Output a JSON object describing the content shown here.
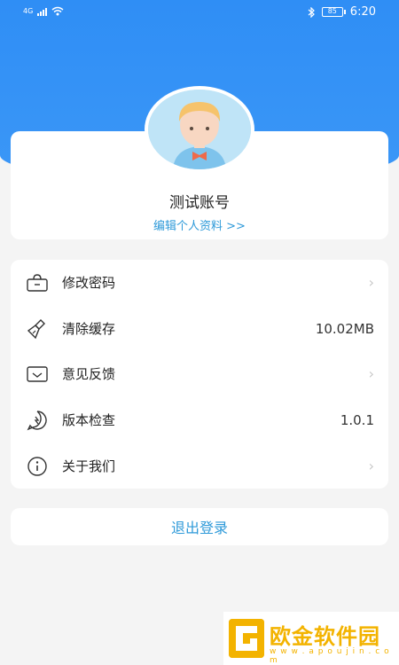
{
  "status_bar": {
    "network": "4G",
    "time": "6:20",
    "battery": "85"
  },
  "profile": {
    "username": "测试账号",
    "edit_link": "编辑个人资料 >>"
  },
  "menu": {
    "items": [
      {
        "label": "修改密码",
        "icon": "lock-icon",
        "value": "",
        "chevron": "›"
      },
      {
        "label": "清除缓存",
        "icon": "broom-icon",
        "value": "10.02MB",
        "chevron": ""
      },
      {
        "label": "意见反馈",
        "icon": "mail-icon",
        "value": "",
        "chevron": "›"
      },
      {
        "label": "版本检查",
        "icon": "update-icon",
        "value": "1.0.1",
        "chevron": ""
      },
      {
        "label": "关于我们",
        "icon": "info-icon",
        "value": "",
        "chevron": "›"
      }
    ]
  },
  "logout_label": "退出登录",
  "watermark": {
    "text": "欧金软件园",
    "url": "w w w . a p o u j i n . c o m"
  },
  "colors": {
    "header_blue": "#2f8ef5",
    "accent": "#2f9ad9",
    "background": "#f4f4f4"
  }
}
